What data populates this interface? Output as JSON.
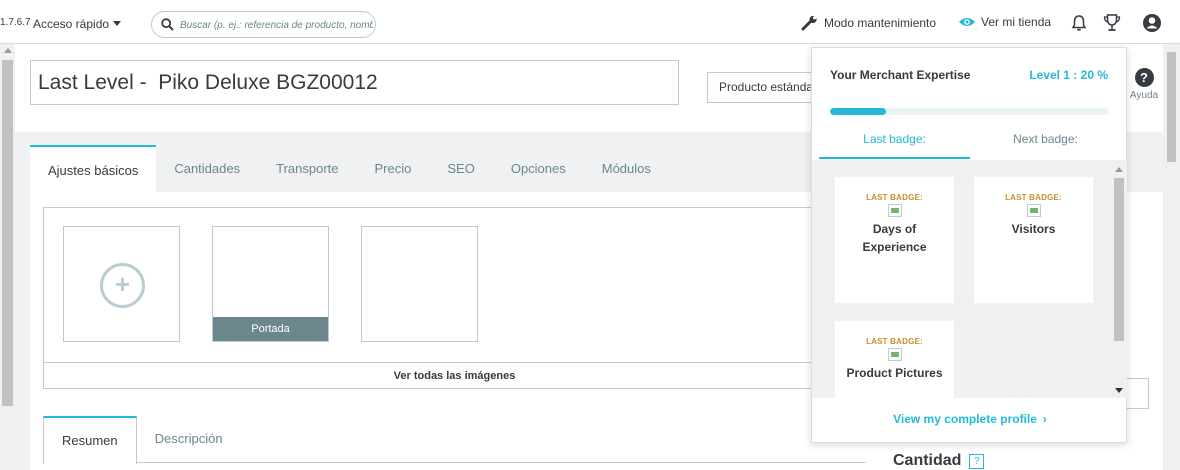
{
  "header": {
    "version": "1.7.6.7",
    "quick_access": "Acceso rápido",
    "search_placeholder": "Buscar (p. ej.: referencia de producto, nombre de cliente…)",
    "maintenance": "Modo mantenimiento",
    "view_store": "Ver mi tienda"
  },
  "product": {
    "name": "Last Level -  Piko Deluxe BGZ00012",
    "type": "Producto estándar",
    "help": "Ayuda"
  },
  "tabs": [
    "Ajustes básicos",
    "Cantidades",
    "Transporte",
    "Precio",
    "SEO",
    "Opciones",
    "Módulos"
  ],
  "images": {
    "cover_label": "Portada",
    "see_all": "Ver todas las imágenes"
  },
  "subtabs": [
    "Resumen",
    "Descripción"
  ],
  "right_col": {
    "quantity_title": "Cantidad",
    "quantity_help": "?"
  },
  "gamification": {
    "title": "Your Merchant Expertise",
    "level": "Level 1 : 20 %",
    "progress": 0.2,
    "tab_last": "Last badge:",
    "tab_next": "Next badge:",
    "badges": [
      {
        "label": "LAST BADGE:",
        "name": "Days of Experience"
      },
      {
        "label": "LAST BADGE:",
        "name": "Visitors"
      },
      {
        "label": "LAST BADGE:",
        "name": "Product Pictures"
      }
    ],
    "footer": "View my complete profile"
  },
  "colors": {
    "accent": "#25b9d7",
    "text": "#363a41",
    "muted": "#6c868e",
    "border": "#bbcdd2",
    "badge_label": "#c4922a"
  }
}
